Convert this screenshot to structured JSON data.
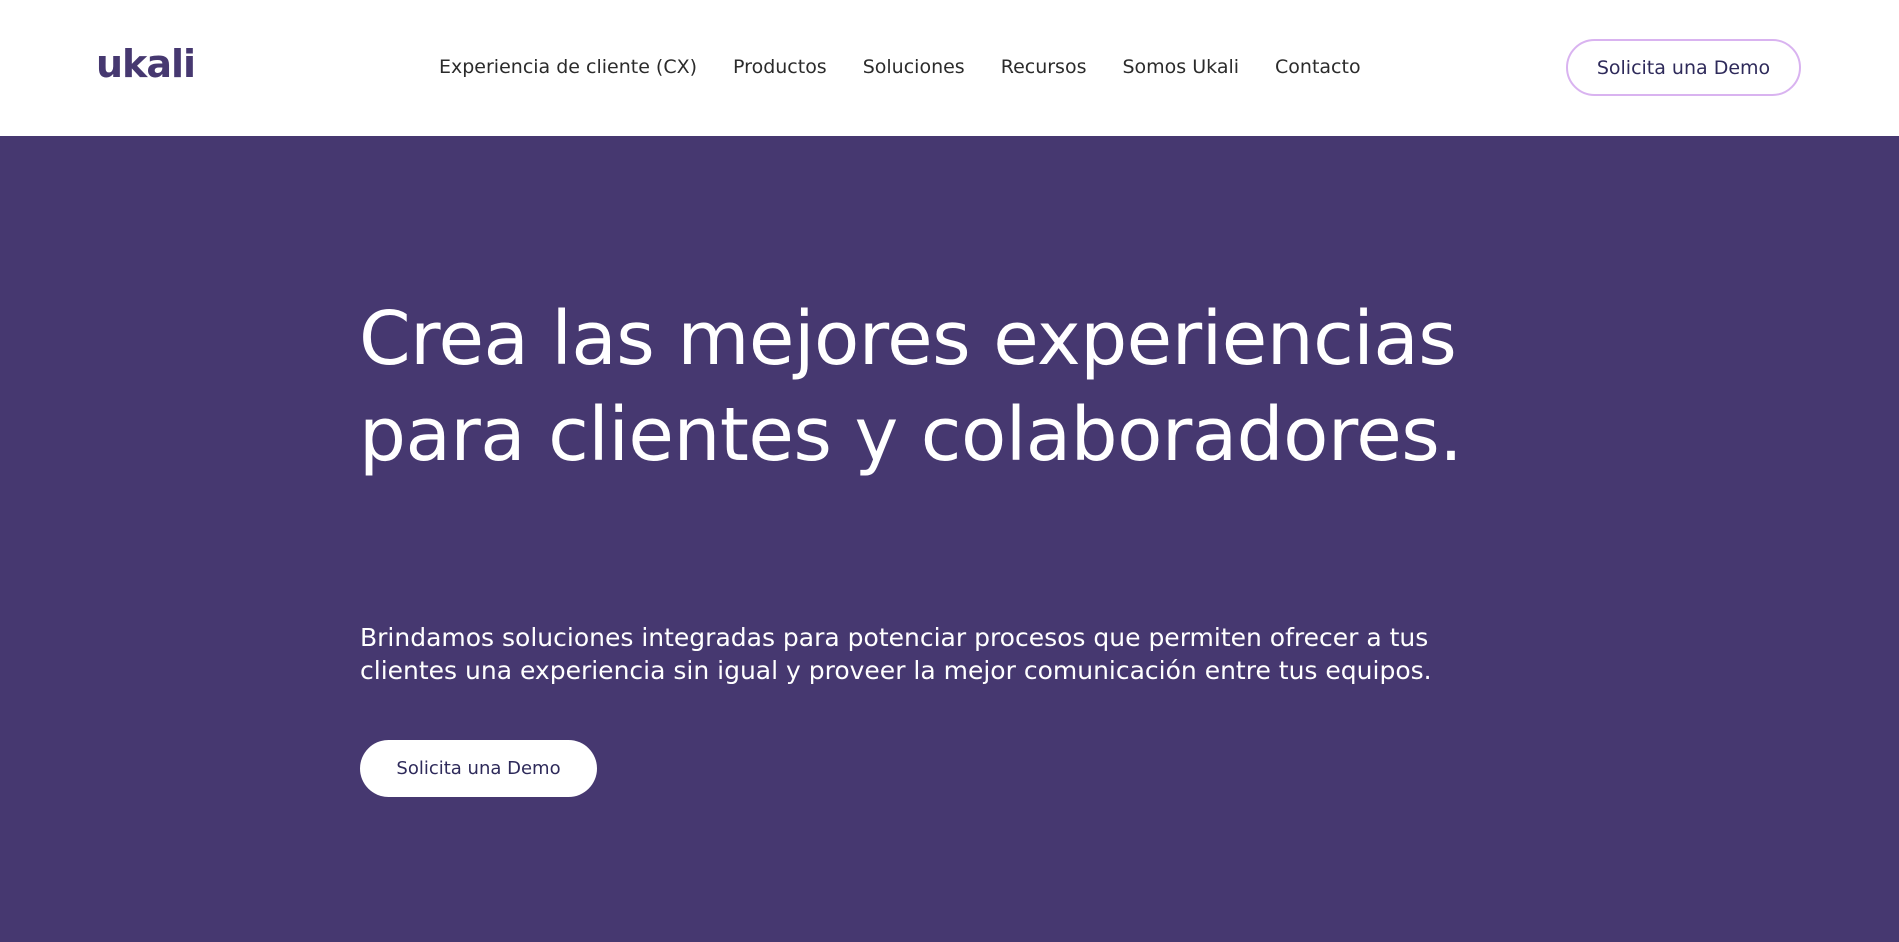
{
  "header": {
    "logo_text": "ukali",
    "nav": [
      {
        "label": "Experiencia de cliente (CX)"
      },
      {
        "label": "Productos"
      },
      {
        "label": "Soluciones"
      },
      {
        "label": "Recursos"
      },
      {
        "label": "Somos Ukali"
      },
      {
        "label": "Contacto"
      }
    ],
    "cta_label": "Solicita una Demo"
  },
  "hero": {
    "title": "Crea las mejores experiencias para clientes y colaboradores.",
    "subtitle": "Brindamos soluciones integradas para potenciar procesos que permiten ofrecer a tus clientes una experiencia sin igual y proveer la mejor comunicación entre tus equipos.",
    "cta_label": "Solicita una Demo"
  },
  "colors": {
    "brand": "#463870",
    "hero_background": "#463870",
    "button_border": "#d9b3f0",
    "button_text": "#2e2a5a"
  }
}
